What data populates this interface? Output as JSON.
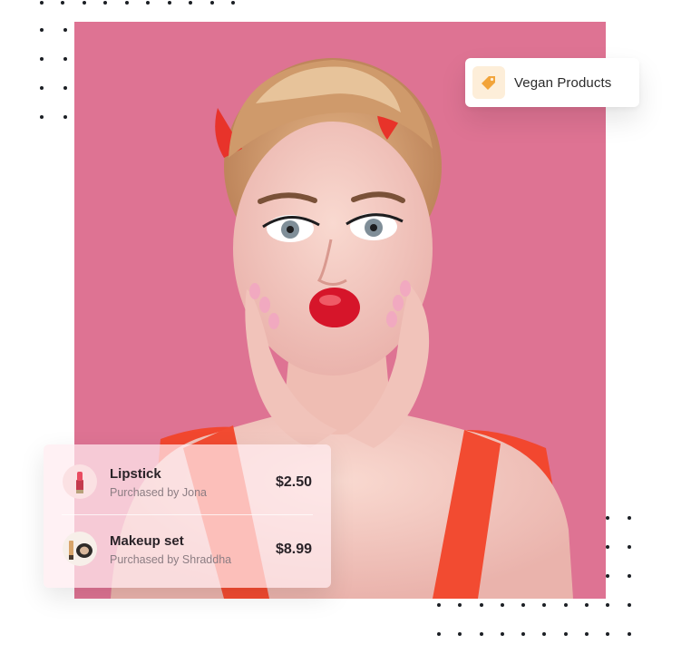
{
  "badge": {
    "label": "Vegan Products",
    "icon": "price-tag-icon",
    "icon_color": "#f2a43a"
  },
  "photo": {
    "background_color": "#de7393",
    "subject": "woman-portrait"
  },
  "purchases": [
    {
      "name": "Lipstick",
      "subtitle": "Purchased by Jona",
      "price": "$2.50",
      "icon": "lipstick-icon"
    },
    {
      "name": "Makeup set",
      "subtitle": "Purchased by Shraddha",
      "price": "$8.99",
      "icon": "makeup-set-icon"
    }
  ]
}
